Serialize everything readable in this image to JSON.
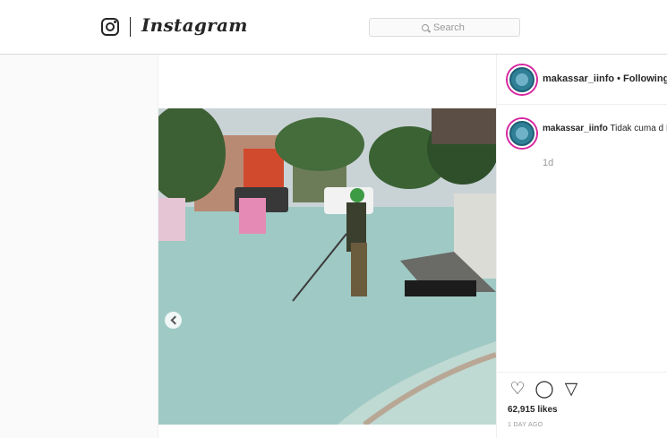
{
  "nav": {
    "logo_icon": "instagram-camera-icon",
    "wordmark": "Instagram",
    "search_placeholder": "Search",
    "search_icon": "search-icon"
  },
  "post": {
    "username": "makassar_iinfo",
    "follow_status": "Following",
    "separator": "•",
    "caption_text": "Tidak cuma d Indonesiapun bisa 😜",
    "caption_time": "1d",
    "likes": "62,915 likes",
    "posted_ago": "1 DAY AGO",
    "photo_description_icon": "photo",
    "prev_icon": "chevron-left-icon",
    "action_icons": [
      "heart-icon",
      "comment-icon",
      "share-icon"
    ]
  },
  "colors": {
    "border": "#dbdbdb",
    "text": "#262626",
    "muted": "#999999",
    "ring": "#d6249f"
  }
}
